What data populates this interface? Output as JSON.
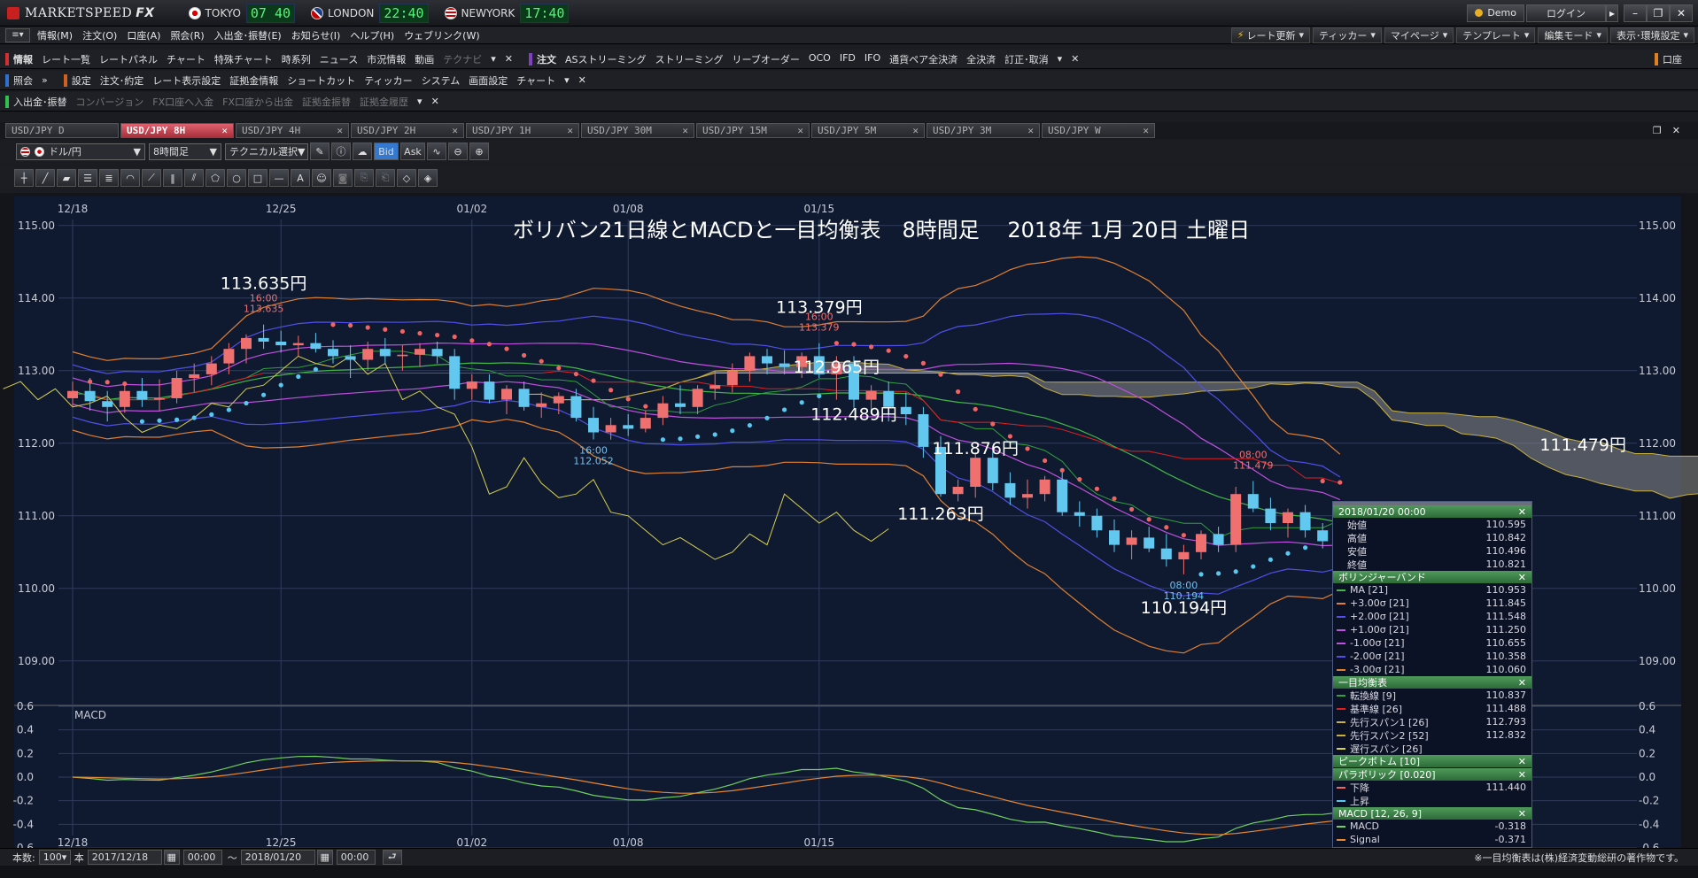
{
  "app": {
    "title": "MARKETSPEED FX",
    "logo_main": "MARKETSPEED",
    "logo_suffix": "FX"
  },
  "clocks": [
    {
      "city": "TOKYO",
      "time": "07 40",
      "flag": "jp"
    },
    {
      "city": "LONDON",
      "time": "22:40",
      "flag": "uk"
    },
    {
      "city": "NEWYORK",
      "time": "17:40",
      "flag": "us"
    }
  ],
  "window": {
    "demo": "Demo",
    "login": "ログイン"
  },
  "menu": [
    "情報(M)",
    "注文(O)",
    "口座(A)",
    "照会(R)",
    "入出金･振替(E)",
    "お知らせ(I)",
    "ヘルプ(H)",
    "ウェブリンク(W)"
  ],
  "menu_right": [
    "レート更新",
    "ティッカー",
    "マイページ",
    "テンプレート",
    "編集モード",
    "表示･環境設定"
  ],
  "toolbar1": {
    "info_label": "情報",
    "info_items": [
      "レート一覧",
      "レートパネル",
      "チャート",
      "特殊チャート",
      "時系列",
      "ニュース",
      "市況情報",
      "動画",
      "テクナビ"
    ],
    "order_label": "注文",
    "order_items": [
      "ASストリーミング",
      "ストリーミング",
      "リーブオーダー",
      "OCO",
      "IFD",
      "IFO",
      "通貨ペア全決済",
      "全決済",
      "訂正･取消"
    ],
    "account_label": "口座"
  },
  "toolbar2": {
    "inquiry_label": "照会",
    "settings_label": "設定",
    "settings_items": [
      "注文･約定",
      "レート表示設定",
      "証拠金情報",
      "ショートカット",
      "ティッカー",
      "システム",
      "画面設定",
      "チャート"
    ]
  },
  "toolbar3": {
    "label": "入出金･振替",
    "items": [
      "コンバージョン",
      "FX口座へ入金",
      "FX口座から出金",
      "証拠金振替",
      "証拠金履歴"
    ]
  },
  "tabs": [
    {
      "label": "USD/JPY D",
      "active": false
    },
    {
      "label": "USD/JPY 8H",
      "active": true
    },
    {
      "label": "USD/JPY 4H",
      "active": false
    },
    {
      "label": "USD/JPY 2H",
      "active": false
    },
    {
      "label": "USD/JPY 1H",
      "active": false
    },
    {
      "label": "USD/JPY 30M",
      "active": false
    },
    {
      "label": "USD/JPY 15M",
      "active": false
    },
    {
      "label": "USD/JPY 5M",
      "active": false
    },
    {
      "label": "USD/JPY 3M",
      "active": false
    },
    {
      "label": "USD/JPY W",
      "active": false
    }
  ],
  "chart_toolbar": {
    "pair": "ドル/円",
    "timeframe": "8時間足",
    "technical": "テクニカル選択",
    "bid": "Bid",
    "ask": "Ask"
  },
  "chart_title": "ボリバン21日線とMACDと一目均衡表　8時間足　 2018年 1月 20日 土曜日",
  "colors": {
    "bull": "#f07070",
    "bear": "#62c8f0",
    "ma": "#40b848",
    "sigma1": "#c050e0",
    "sigma2": "#5050e8",
    "sigma3": "#e08030",
    "tenkan": "#30a040",
    "kijun": "#e02020",
    "chikou": "#d8d050",
    "span": "#c8b040",
    "psar_down": "#f06464",
    "psar_up": "#58c8f0",
    "macd": "#70d060",
    "signal": "#e88830"
  },
  "chart_data": {
    "type": "candlestick",
    "date_labels": [
      "12/18",
      "12/25",
      "01/02",
      "01/08",
      "01/15"
    ],
    "y_ticks": [
      "115.00",
      "114.00",
      "113.00",
      "112.00",
      "111.00",
      "110.00",
      "109.00"
    ],
    "macd_ticks": [
      "0.6",
      "0.4",
      "0.2",
      "0.0",
      "-0.2",
      "-0.4",
      "-0.6"
    ],
    "macd_label": "MACD",
    "price_ylim": [
      108.4,
      115.4
    ],
    "macd_ylim": [
      -0.6,
      0.6
    ],
    "ohlc": [
      [
        112.62,
        112.85,
        112.5,
        112.72
      ],
      [
        112.72,
        112.9,
        112.45,
        112.58
      ],
      [
        112.58,
        112.72,
        112.3,
        112.5
      ],
      [
        112.5,
        112.8,
        112.42,
        112.72
      ],
      [
        112.72,
        112.9,
        112.5,
        112.6
      ],
      [
        112.6,
        112.88,
        112.45,
        112.62
      ],
      [
        112.62,
        113.0,
        112.55,
        112.9
      ],
      [
        112.9,
        113.1,
        112.7,
        112.95
      ],
      [
        112.95,
        113.2,
        112.8,
        113.1
      ],
      [
        113.1,
        113.38,
        112.95,
        113.3
      ],
      [
        113.3,
        113.5,
        113.1,
        113.45
      ],
      [
        113.45,
        113.635,
        113.3,
        113.4
      ],
      [
        113.4,
        113.55,
        113.25,
        113.35
      ],
      [
        113.35,
        113.48,
        113.2,
        113.38
      ],
      [
        113.38,
        113.52,
        113.25,
        113.3
      ],
      [
        113.3,
        113.42,
        113.1,
        113.2
      ],
      [
        113.2,
        113.35,
        112.9,
        113.15
      ],
      [
        113.15,
        113.4,
        113.0,
        113.3
      ],
      [
        113.3,
        113.45,
        113.1,
        113.2
      ],
      [
        113.2,
        113.35,
        113.0,
        113.22
      ],
      [
        113.22,
        113.38,
        113.05,
        113.3
      ],
      [
        113.3,
        113.4,
        113.1,
        113.2
      ],
      [
        113.2,
        113.3,
        112.6,
        112.75
      ],
      [
        112.75,
        112.95,
        112.6,
        112.85
      ],
      [
        112.85,
        112.95,
        112.55,
        112.6
      ],
      [
        112.6,
        112.8,
        112.4,
        112.75
      ],
      [
        112.75,
        112.85,
        112.45,
        112.5
      ],
      [
        112.5,
        112.7,
        112.35,
        112.55
      ],
      [
        112.55,
        112.7,
        112.4,
        112.65
      ],
      [
        112.65,
        112.75,
        112.3,
        112.35
      ],
      [
        112.35,
        112.5,
        112.052,
        112.15
      ],
      [
        112.15,
        112.35,
        112.05,
        112.25
      ],
      [
        112.25,
        112.4,
        112.1,
        112.2
      ],
      [
        112.2,
        112.45,
        112.15,
        112.35
      ],
      [
        112.35,
        112.65,
        112.25,
        112.55
      ],
      [
        112.55,
        112.8,
        112.4,
        112.5
      ],
      [
        112.5,
        112.8,
        112.4,
        112.75
      ],
      [
        112.75,
        113.0,
        112.6,
        112.8
      ],
      [
        112.8,
        113.1,
        112.7,
        113.0
      ],
      [
        113.0,
        113.25,
        112.85,
        113.2
      ],
      [
        113.2,
        113.3,
        112.95,
        113.1
      ],
      [
        113.1,
        113.28,
        112.95,
        113.05
      ],
      [
        113.05,
        113.25,
        112.9,
        113.2
      ],
      [
        113.2,
        113.379,
        112.9,
        112.95
      ],
      [
        112.95,
        113.2,
        112.6,
        113.1
      ],
      [
        113.1,
        113.2,
        112.489,
        112.6
      ],
      [
        112.6,
        112.8,
        112.45,
        112.72
      ],
      [
        112.72,
        112.85,
        112.3,
        112.5
      ],
      [
        112.5,
        112.7,
        112.25,
        112.4
      ],
      [
        112.4,
        112.5,
        111.8,
        111.95
      ],
      [
        111.95,
        112.1,
        111.263,
        111.3
      ],
      [
        111.3,
        111.5,
        111.2,
        111.4
      ],
      [
        111.4,
        111.876,
        111.25,
        111.8
      ],
      [
        111.8,
        111.9,
        111.35,
        111.45
      ],
      [
        111.45,
        111.6,
        111.15,
        111.25
      ],
      [
        111.25,
        111.5,
        111.1,
        111.3
      ],
      [
        111.3,
        111.55,
        111.2,
        111.5
      ],
      [
        111.5,
        111.6,
        111.0,
        111.05
      ],
      [
        111.05,
        111.2,
        110.85,
        111.0
      ],
      [
        111.0,
        111.1,
        110.7,
        110.8
      ],
      [
        110.8,
        110.95,
        110.5,
        110.6
      ],
      [
        110.6,
        110.8,
        110.4,
        110.7
      ],
      [
        110.7,
        110.85,
        110.5,
        110.55
      ],
      [
        110.55,
        110.75,
        110.3,
        110.4
      ],
      [
        110.4,
        110.6,
        110.194,
        110.5
      ],
      [
        110.5,
        110.8,
        110.4,
        110.75
      ],
      [
        110.75,
        110.85,
        110.5,
        110.6
      ],
      [
        110.6,
        111.4,
        110.5,
        111.3
      ],
      [
        111.3,
        111.479,
        111.05,
        111.1
      ],
      [
        111.1,
        111.25,
        110.8,
        110.9
      ],
      [
        110.9,
        111.1,
        110.7,
        111.05
      ],
      [
        111.05,
        111.15,
        110.7,
        110.8
      ],
      [
        110.8,
        110.9,
        110.55,
        110.65
      ],
      [
        110.595,
        110.842,
        110.496,
        110.821
      ]
    ],
    "annotations": [
      {
        "text": "113.635円",
        "sub_time": "16:00",
        "sub_price": "113.635"
      },
      {
        "text": "113.379円",
        "sub_time": "16:00",
        "sub_price": "113.379"
      },
      {
        "text": "112.965円"
      },
      {
        "text": "112.489円"
      },
      {
        "text": "111.876円"
      },
      {
        "text": "111.263円"
      },
      {
        "text": "110.194円",
        "sub_time": "08:00",
        "sub_price": "110.194"
      },
      {
        "text": "111.479円",
        "sub_time": "08:00",
        "sub_price": "111.479"
      },
      {
        "sub_time": "16:00",
        "sub_price": "112.052"
      }
    ]
  },
  "data_panel": {
    "header": "2018/01/20 00:00",
    "ohlc": [
      {
        "label": "始値",
        "value": "110.595"
      },
      {
        "label": "高値",
        "value": "110.842"
      },
      {
        "label": "安値",
        "value": "110.496"
      },
      {
        "label": "終値",
        "value": "110.821"
      }
    ],
    "boll_header": "ボリンジャーバンド",
    "boll": [
      {
        "label": "MA [21]",
        "value": "110.953",
        "color": "#40b848"
      },
      {
        "label": "+3.00σ [21]",
        "value": "111.845",
        "color": "#e08030"
      },
      {
        "label": "+2.00σ [21]",
        "value": "111.548",
        "color": "#5050e8"
      },
      {
        "label": "+1.00σ [21]",
        "value": "111.250",
        "color": "#c050e0"
      },
      {
        "label": "-1.00σ [21]",
        "value": "110.655",
        "color": "#c050e0"
      },
      {
        "label": "-2.00σ [21]",
        "value": "110.358",
        "color": "#5050e8"
      },
      {
        "label": "-3.00σ [21]",
        "value": "110.060",
        "color": "#e08030"
      }
    ],
    "ichi_header": "一目均衡表",
    "ichi": [
      {
        "label": "転換線 [9]",
        "value": "110.837",
        "color": "#30a040"
      },
      {
        "label": "基準線 [26]",
        "value": "111.488",
        "color": "#e02020"
      },
      {
        "label": "先行スパン1 [26]",
        "value": "112.793",
        "color": "#c8b040"
      },
      {
        "label": "先行スパン2 [52]",
        "value": "112.832",
        "color": "#c8b040"
      },
      {
        "label": "遅行スパン [26]",
        "value": "",
        "color": "#d8d050"
      }
    ],
    "peak_header": "ピークボトム [10]",
    "psar_header": "パラボリック [0.020]",
    "psar": [
      {
        "label": "下降",
        "value": "111.440",
        "color": "#f06464"
      },
      {
        "label": "上昇",
        "value": "",
        "color": "#58c8f0"
      }
    ],
    "macd_header": "MACD [12, 26, 9]",
    "macd": [
      {
        "label": "MACD",
        "value": "-0.318",
        "color": "#70d060"
      },
      {
        "label": "Signal",
        "value": "-0.371",
        "color": "#e88830"
      }
    ]
  },
  "status": {
    "count_label": "本数:",
    "count": "100",
    "unit": "本",
    "from_date": "2017/12/18",
    "from_time": "00:00",
    "tilde": "～",
    "to_date": "2018/01/20",
    "to_time": "00:00",
    "copyright": "※一目均衡表は(株)経済変動総研の著作物です。"
  }
}
